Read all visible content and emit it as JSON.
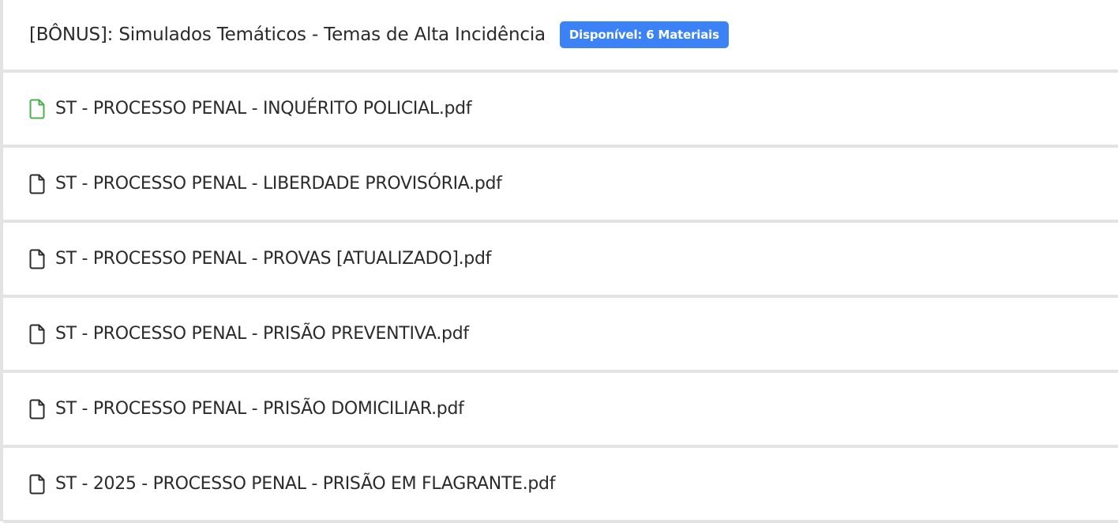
{
  "section": {
    "title": "[BÔNUS]: Simulados Temáticos - Temas de Alta Incidência",
    "badge": "Disponível: 6 Materiais",
    "badge_color": "#3b82f6"
  },
  "files": [
    {
      "name": "ST - PROCESSO PENAL - INQUÉRITO POLICIAL.pdf",
      "icon": "file-icon",
      "icon_color": "#4caf50"
    },
    {
      "name": "ST - PROCESSO PENAL - LIBERDADE PROVISÓRIA.pdf",
      "icon": "file-icon",
      "icon_color": "#2b2b2b"
    },
    {
      "name": "ST - PROCESSO PENAL - PROVAS [ATUALIZADO].pdf",
      "icon": "file-icon",
      "icon_color": "#2b2b2b"
    },
    {
      "name": "ST - PROCESSO PENAL - PRISÃO PREVENTIVA.pdf",
      "icon": "file-icon",
      "icon_color": "#2b2b2b"
    },
    {
      "name": "ST - PROCESSO PENAL - PRISÃO DOMICILIAR.pdf",
      "icon": "file-icon",
      "icon_color": "#2b2b2b"
    },
    {
      "name": "ST - 2025 - PROCESSO PENAL - PRISÃO EM FLAGRANTE.pdf",
      "icon": "file-icon",
      "icon_color": "#2b2b2b"
    }
  ]
}
